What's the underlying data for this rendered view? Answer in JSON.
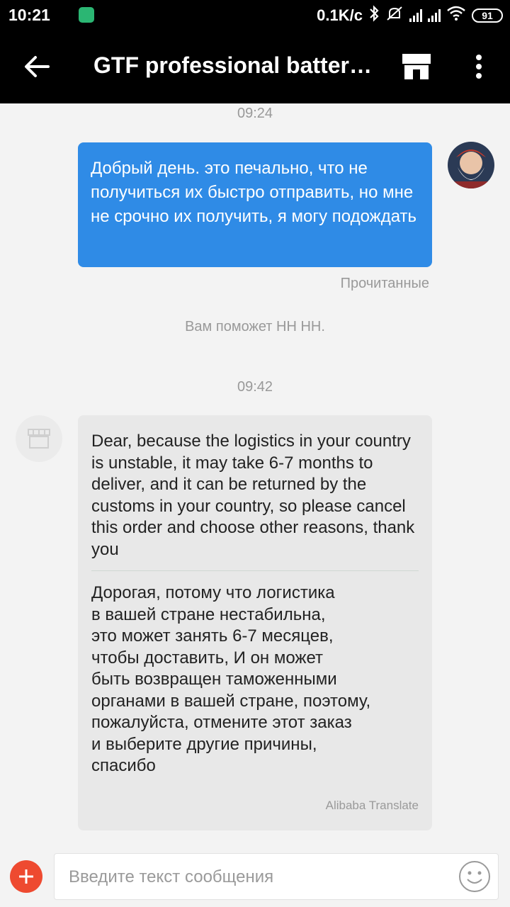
{
  "status_bar": {
    "time": "10:21",
    "speed": "0.1K/c",
    "battery": "91"
  },
  "header": {
    "title": "GTF professional battery...",
    "icons": [
      "back-arrow-icon",
      "store-icon",
      "more-vert-icon"
    ]
  },
  "chat": {
    "timestamp_1": "09:24",
    "my_message": "Добрый день. это печально, что не получиться их быстро отправить, но мне не срочно их получить, я могу подождать",
    "read_status": "Прочитанные",
    "system_message": "Вам поможет НН НН.",
    "timestamp_2": "09:42",
    "seller_message": "Dear, because the logistics in your country is unstable, it may take 6-7 months to deliver, and it can be returned by the customs in your country, so please cancel this order and choose other reasons, thank you",
    "seller_translation": "Дорогая, потому что логистика\nв вашей стране нестабильна,\nэто может занять 6-7 месяцев,\nчтобы доставить, И он может\nбыть возвращен таможенными\nорганами в вашей стране, поэтому,\nпожалуйста, отмените этот заказ\nи выберите другие причины,\nспасибо",
    "translation_credit": "Alibaba Translate"
  },
  "input": {
    "placeholder": "Введите текст сообщения"
  },
  "colors": {
    "header_bg": "#000000",
    "my_bubble": "#2f8be6",
    "other_bubble": "#e8e8e8",
    "plus_button": "#ee4a30"
  }
}
